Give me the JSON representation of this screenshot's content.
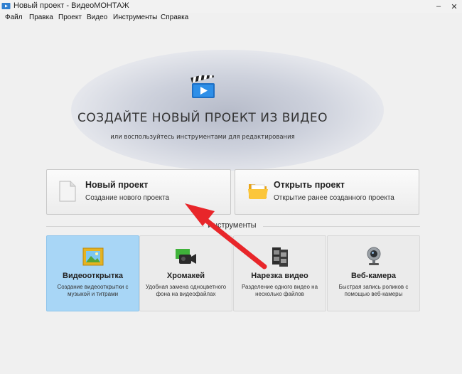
{
  "window": {
    "title": "Новый проект - ВидеоМОНТАЖ",
    "minimize": "–",
    "close": "✕"
  },
  "menu": [
    "Файл",
    "Правка",
    "Проект",
    "Видео",
    "Инструменты",
    "Справка"
  ],
  "hero": {
    "title": "СОЗДАЙТЕ НОВЫЙ ПРОЕКТ ИЗ ВИДЕО",
    "subtitle": "или воспользуйтесь инструментами для редактирования"
  },
  "actions": [
    {
      "title": "Новый проект",
      "subtitle": "Создание нового проекта",
      "icon": "blank-document-icon"
    },
    {
      "title": "Открыть проект",
      "subtitle": "Открытие ранее созданного проекта",
      "icon": "folder-icon"
    }
  ],
  "tools": {
    "label": "Инструменты",
    "items": [
      {
        "title": "Видеооткрытка",
        "desc": "Создание видеооткрытки с музыкой и титрами",
        "icon": "picture-frame-icon",
        "active": true
      },
      {
        "title": "Хромакей",
        "desc": "Удобная замена одноцветного фона на видеофайлах",
        "icon": "camcorder-icon",
        "active": false
      },
      {
        "title": "Нарезка видео",
        "desc": "Разделение одного видео на несколько файлов",
        "icon": "film-strip-icon",
        "active": false
      },
      {
        "title": "Веб-камера",
        "desc": "Быстрая запись роликов с помощью веб-камеры",
        "icon": "webcam-icon",
        "active": false
      }
    ]
  },
  "colors": {
    "active_tile": "#a8d6f6",
    "arrow": "#e8262a"
  }
}
